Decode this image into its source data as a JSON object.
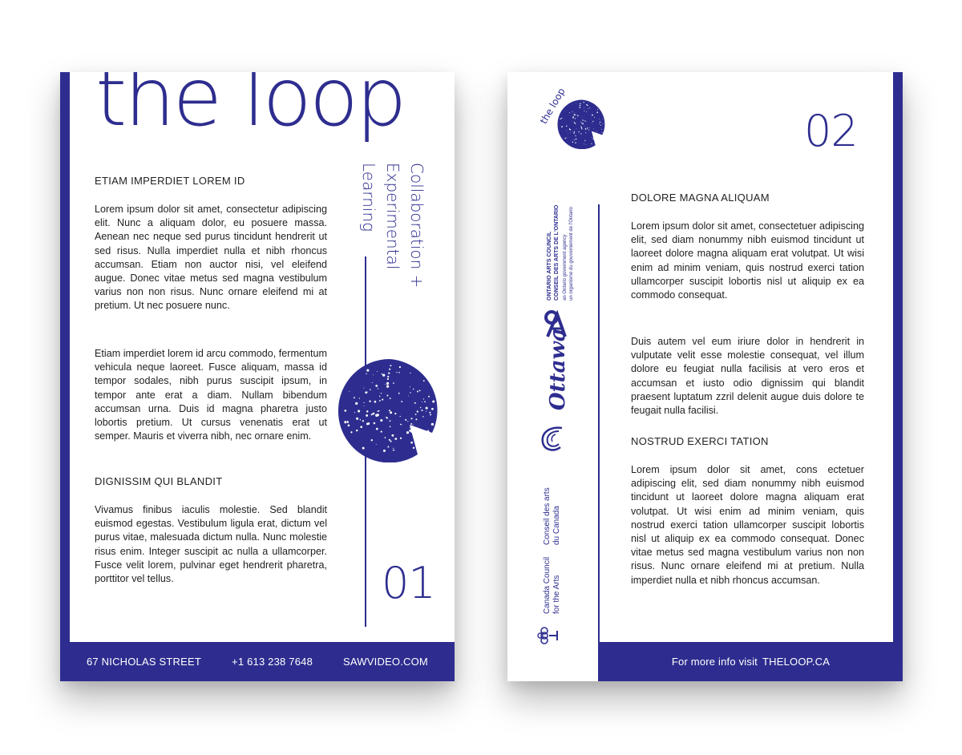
{
  "page1": {
    "title": "the loop",
    "vertical_text": [
      "Collaboration +",
      "Experimental",
      "Learning"
    ],
    "sections": [
      {
        "heading": "ETIAM IMPERDIET LOREM ID",
        "paragraphs": [
          "Lorem ipsum dolor sit amet, consectetur adipiscing elit. Nunc a aliquam dolor, eu posuere massa. Aenean nec neque sed purus tincidunt hendrerit ut sed risus. Nulla imperdiet nulla et nibh rhoncus accumsan. Etiam non auctor nisi, vel eleifend augue. Donec vitae metus sed magna vestibulum varius non non risus. Nunc ornare eleifend mi at pretium. Ut nec posuere nunc.",
          "Etiam imperdiet lorem id arcu commodo, fermentum vehicula neque laoreet. Fusce aliquam, massa id tempor sodales, nibh purus suscipit ipsum, in tempor ante erat a diam. Nullam bibendum accumsan urna. Duis id magna pharetra justo lobortis pretium. Ut cursus venenatis erat ut semper. Mauris et viverra nibh, nec ornare enim."
        ]
      },
      {
        "heading": "DIGNISSIM QUI BLANDIT",
        "paragraphs": [
          "Vivamus finibus iaculis molestie. Sed blandit euismod egestas. Vestibulum ligula erat, dictum vel purus vitae, malesuada dictum nulla. Nunc molestie risus enim. Integer suscipit ac nulla a ullamcorper. Fusce velit lorem, pulvinar eget hendrerit pharetra, porttitor vel tellus."
        ]
      }
    ],
    "page_number": "01",
    "footer": {
      "address": "67 NICHOLAS STREET",
      "phone": "+1 613 238 7648",
      "website": "SAWVIDEO.COM"
    }
  },
  "page2": {
    "logo_text": "the loop",
    "page_number": "02",
    "sections": [
      {
        "heading": "DOLORE MAGNA ALIQUAM",
        "paragraphs": [
          "Lorem ipsum dolor sit amet, consectetuer adipiscing elit, sed diam nonummy nibh euismod tincidunt ut laoreet dolore magna aliquam erat volutpat. Ut wisi enim ad minim veniam, quis nostrud exerci tation ullamcorper suscipit lobortis nisl ut aliquip ex ea commodo consequat.",
          "Duis autem vel eum iriure dolor in hendrerit in vulputate velit esse molestie consequat, vel illum dolore eu feugiat nulla facilisis at vero eros et accumsan et iusto odio dignissim qui blandit praesent luptatum zzril delenit augue duis dolore te feugait nulla facilisi."
        ]
      },
      {
        "heading": "NOSTRUD EXERCI TATION",
        "paragraphs": [
          "Lorem ipsum dolor sit amet, cons ectetuer adipiscing elit, sed diam nonummy nibh euismod tincidunt ut laoreet dolore magna aliquam erat volutpat. Ut wisi enim ad minim veniam, quis nostrud exerci tation ullamcorper suscipit lobortis nisl ut aliquip ex ea commodo consequat. Donec vitae metus sed magna vestibulum varius non non risus. Nunc ornare eleifend mi at pretium. Nulla imperdiet nulla et nibh rhoncus accumsan."
        ]
      }
    ],
    "sponsors": {
      "oac_line1": "ONTARIO ARTS COUNCIL",
      "oac_line2": "CONSEIL DES ARTS DE L'ONTARIO",
      "oac_line3": "an Ontario government agency",
      "oac_line4": "un organisme du gouvernement de l'Ontario",
      "ottawa": "Ottawa",
      "canada_council_en_1": "Canada Council",
      "canada_council_en_2": "for the Arts",
      "canada_council_fr_1": "Conseil des arts",
      "canada_council_fr_2": "du Canada"
    },
    "footer": {
      "prefix": "For more info visit",
      "website": "THELOOP.CA"
    }
  },
  "colors": {
    "brand_blue": "#2e2d8f",
    "text": "#222222"
  },
  "icons": [
    "cosmic-circle-logo",
    "oac-logo-icon",
    "ottawa-swirl-icon",
    "canada-council-emblem-icon"
  ]
}
